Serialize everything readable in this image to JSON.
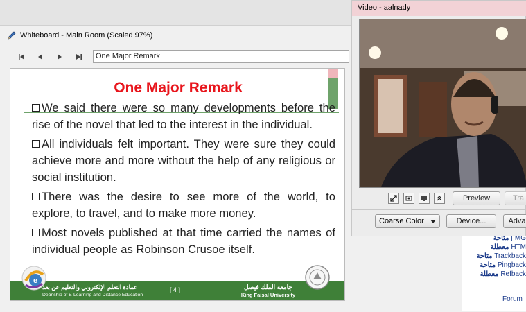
{
  "whiteboard": {
    "title": "Whiteboard - Main Room (Scaled 97%)",
    "slide_selector": "One Major Remark"
  },
  "slide": {
    "title": "One Major Remark",
    "paragraphs": [
      "We said there were so many developments before the rise of the novel that led to the interest in the individual.",
      "All individuals felt important.  They were sure they could achieve more and more without the help of any religious or social institution.",
      "There was the desire to see more of the world, to explore, to travel, and to make more money.",
      "Most novels published at that time carried the names of individual people as Robinson Crusoe itself."
    ],
    "footer": {
      "left_arabic": "عمادة التعلم الإلكتروني والتعليم عن بعد",
      "left_english": "Deanship of E-Learning and Distance Education",
      "page": "[ 4 ]",
      "right_arabic": "جامعة الملك فيصل",
      "right_english": "King Faisal University"
    }
  },
  "video": {
    "title": "Video - aalnady",
    "preview_label": "Preview",
    "transmit_label": "Tra",
    "color_option": "Coarse Color",
    "device_label": "Device...",
    "advanced_label": "Adva"
  },
  "sidebar": {
    "items": [
      {
        "status": "متاحة",
        "name": "[IMG"
      },
      {
        "status": "معطلة",
        "name": "HTM"
      },
      {
        "status": "متاحة",
        "name": "Trackback"
      },
      {
        "status": "متاحة",
        "name": "Pingback"
      },
      {
        "status": "معطلة",
        "name": "Refback"
      }
    ],
    "forum_link": "Forum"
  },
  "colors": {
    "slide_title": "#e8141b",
    "slide_green": "#3f8038",
    "video_title_bg": "#f2d2d6"
  }
}
